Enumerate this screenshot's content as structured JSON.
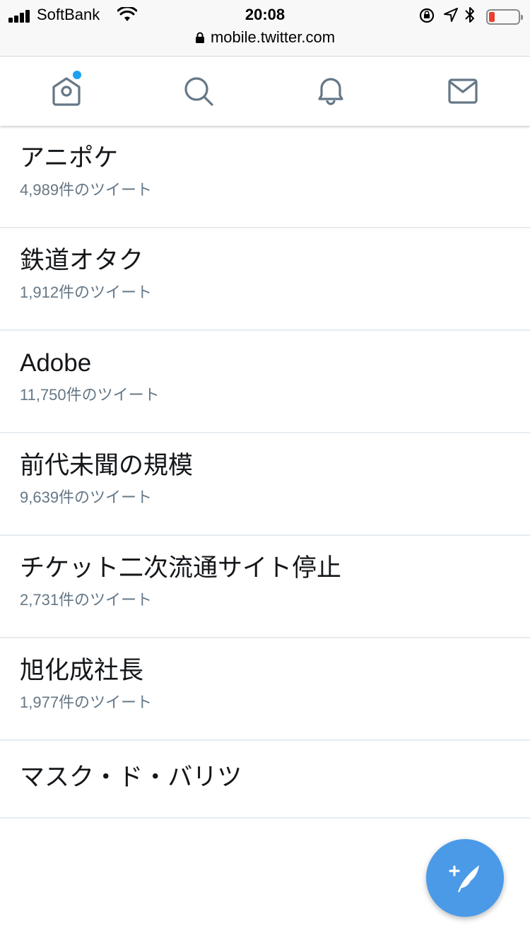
{
  "status_bar": {
    "carrier": "SoftBank",
    "time": "20:08",
    "battery_color": "#e8402f"
  },
  "url_bar": {
    "url": "mobile.twitter.com"
  },
  "nav": {
    "items": [
      {
        "icon": "home-icon",
        "has_badge": true
      },
      {
        "icon": "search-icon"
      },
      {
        "icon": "bell-icon"
      },
      {
        "icon": "mail-icon"
      }
    ],
    "accent": "#1da1f2"
  },
  "trends": [
    {
      "title": "アニポケ",
      "count": "4,989件のツイート"
    },
    {
      "title": "鉄道オタク",
      "count": "1,912件のツイート"
    },
    {
      "title": "Adobe",
      "count": "11,750件のツイート"
    },
    {
      "title": "前代未聞の規模",
      "count": "9,639件のツイート"
    },
    {
      "title": "チケット二次流通サイト停止",
      "count": "2,731件のツイート"
    },
    {
      "title": "旭化成社長",
      "count": "1,977件のツイート"
    },
    {
      "title": "マスク・ド・バリツ"
    }
  ],
  "fab": {
    "icon": "compose-tweet-icon",
    "color": "#4a9ae8"
  }
}
